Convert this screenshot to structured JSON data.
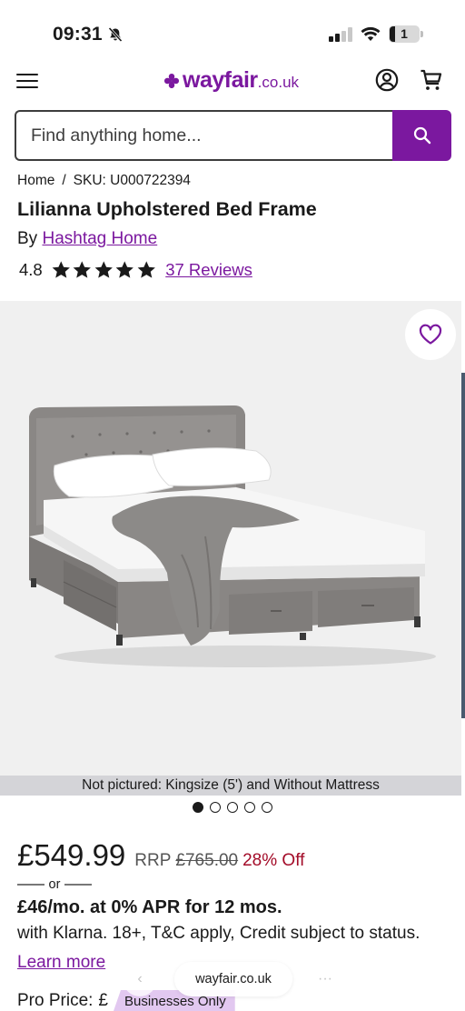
{
  "status_bar": {
    "time": "09:31",
    "battery": "1"
  },
  "header": {
    "logo_word": "wayfair",
    "logo_tld": ".co.uk"
  },
  "search": {
    "placeholder": "Find anything home..."
  },
  "breadcrumb": {
    "home": "Home",
    "separator": "/",
    "sku": "SKU: U000722394"
  },
  "product": {
    "title": "Lilianna Upholstered Bed Frame",
    "by_label": "By",
    "brand": "Hashtag Home",
    "rating": "4.8",
    "stars_filled": 5,
    "stars_total": 5,
    "reviews_link": "37 Reviews"
  },
  "gallery": {
    "caption": "Not pictured: Kingsize (5') and Without Mattress",
    "dot_count": 5,
    "active_index": 0
  },
  "pricing": {
    "price": "£549.99",
    "rrp_label": "RRP",
    "rrp_value": "£765.00",
    "discount": "28% Off",
    "or_text": "or",
    "klarna_headline": "£46/mo. at 0% APR for 12 mos.",
    "klarna_terms": "with Klarna. 18+, T&C apply, Credit subject to status.",
    "learn_more": "Learn more",
    "pro_price_label": "Pro Price:",
    "pro_currency": "£",
    "business_badge": "Businesses Only"
  },
  "browser": {
    "url": "wayfair.co.uk"
  },
  "colors": {
    "brand": "#7b189f",
    "discount": "#a30b28",
    "text": "#1a1a1a"
  }
}
